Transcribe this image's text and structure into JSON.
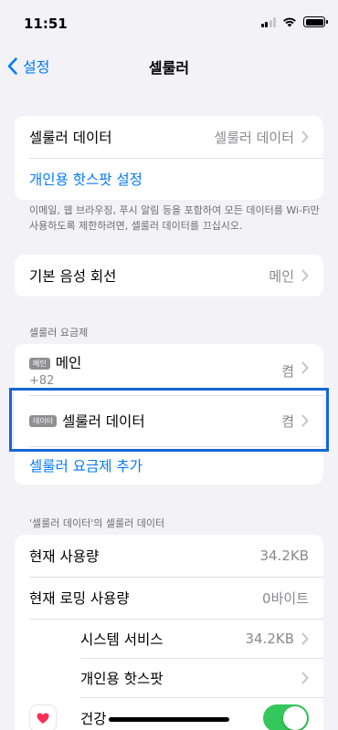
{
  "status": {
    "time": "11:51"
  },
  "nav": {
    "back_label": "설정",
    "title": "셀룰러"
  },
  "cellular_group": {
    "cellular_data": {
      "label": "셀룰러 데이터",
      "value": "셀룰러 데이터"
    },
    "hotspot_link": "개인용 핫스팟 설정"
  },
  "footnote_cellular": "이메일, 웹 브라우징, 푸시 알림 등을 포함하여 모든 데이터를 Wi-Fi만 사용하도록 제한하려면, 셀룰러 데이터를 끄십시오.",
  "voice_line": {
    "label": "기본 음성 회선",
    "value": "메인"
  },
  "plans_section": {
    "header": "셀룰러 요금제",
    "plans": [
      {
        "badge": "메인",
        "name": "메인",
        "subtitle": "+82",
        "value": "켬"
      },
      {
        "badge": "데이터",
        "name": "셀룰러 데이터",
        "value": "켬"
      }
    ],
    "add_plan": "셀룰러 요금제 추가"
  },
  "usage_section": {
    "header": "'셀룰러 데이터'의 셀룰러 데이터",
    "current_usage": {
      "label": "현재 사용량",
      "value": "34.2KB"
    },
    "roaming_usage": {
      "label": "현재 로밍 사용량",
      "value": "0바이트"
    },
    "system_services": {
      "label": "시스템 서비스",
      "value": "34.2KB"
    },
    "personal_hotspot": {
      "label": "개인용 핫스팟"
    },
    "health": {
      "label": "건강",
      "icon": "heart-icon",
      "toggle_on": true
    }
  },
  "colors": {
    "accent": "#007aff",
    "toggle_on": "#34c759",
    "highlight": "#1466d8"
  }
}
